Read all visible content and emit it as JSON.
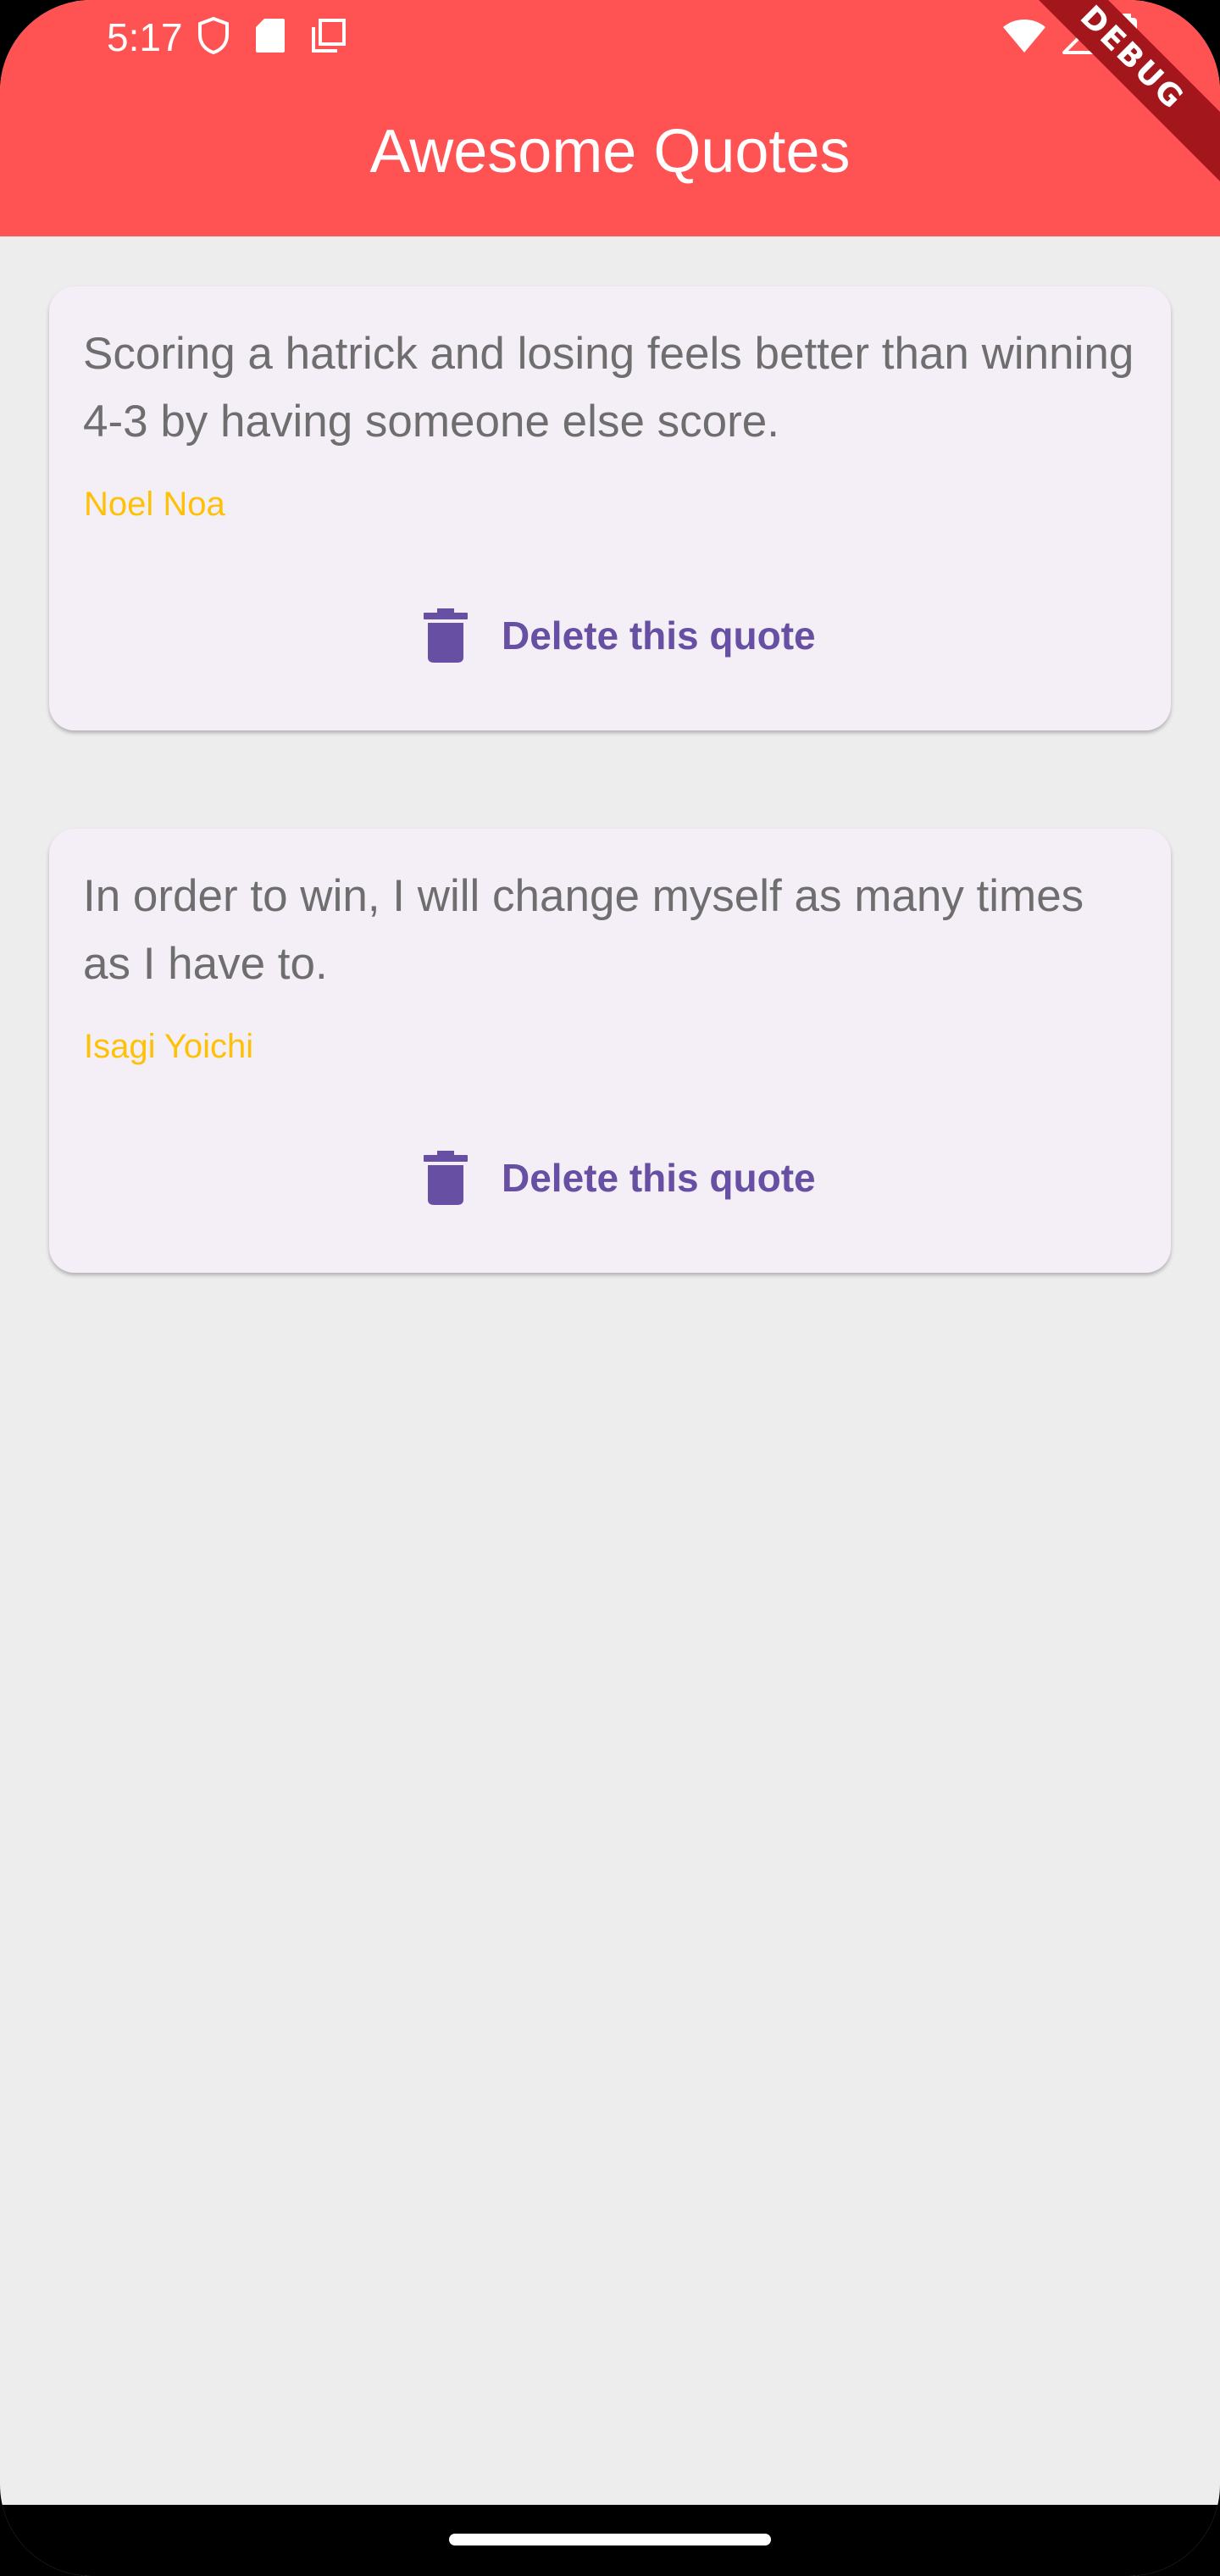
{
  "status_bar": {
    "time": "5:17",
    "left_icons": [
      "shield-icon",
      "sd-card-icon",
      "copy-icon"
    ],
    "right_icons": [
      "wifi-icon",
      "signal-icon",
      "battery-icon"
    ]
  },
  "app_bar": {
    "title": "Awesome Quotes",
    "color": "#ff5252",
    "debug_banner": "DEBUG"
  },
  "quotes": [
    {
      "text": "Scoring a hatrick and losing feels better than winning 4-3 by having someone else score.",
      "author": "Noel Noa",
      "delete_label": "Delete this quote"
    },
    {
      "text": "In order to win, I will change myself as many times as I have to.",
      "author": "Isagi Yoichi",
      "delete_label": "Delete this quote"
    }
  ],
  "colors": {
    "background": "#ededed",
    "card": "#f4eff6",
    "quote_text": "#6e6e6e",
    "author": "#ffc107",
    "action": "#6750a4"
  }
}
